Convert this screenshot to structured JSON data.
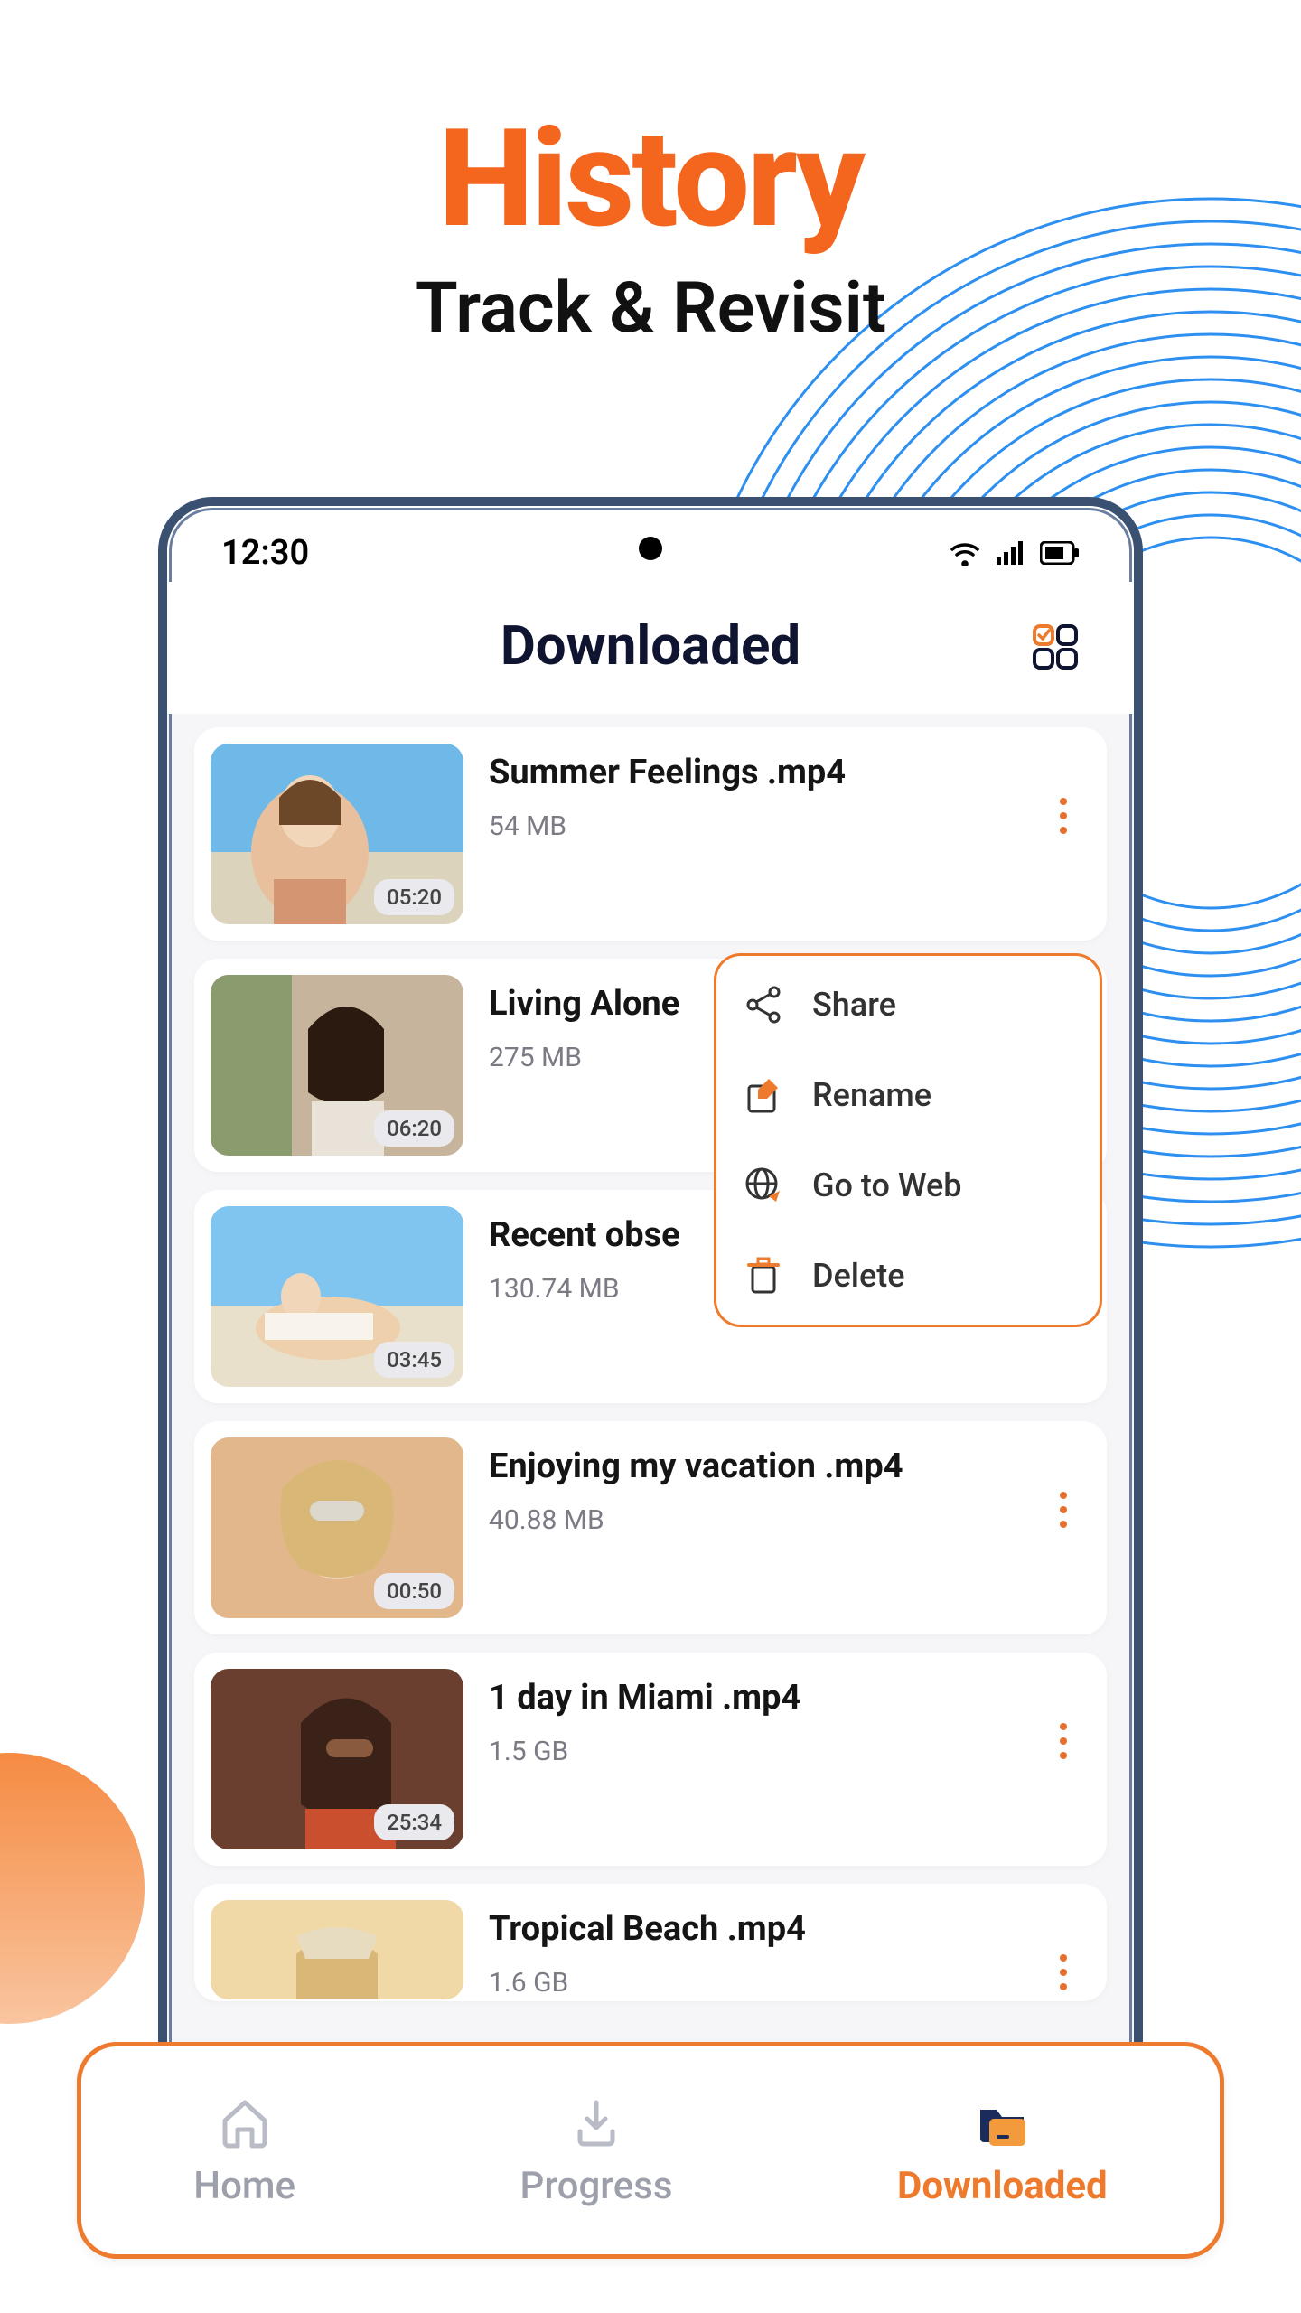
{
  "promo": {
    "title": "History",
    "subtitle": "Track & Revisit"
  },
  "statusBar": {
    "time": "12:30"
  },
  "screen": {
    "title": "Downloaded"
  },
  "items": [
    {
      "title": "Summer Feelings .mp4",
      "size": "54 MB",
      "duration": "05:20"
    },
    {
      "title": "Living Alone",
      "size": "275 MB",
      "duration": "06:20"
    },
    {
      "title": "Recent obse",
      "size": "130.74 MB",
      "duration": "03:45"
    },
    {
      "title": "Enjoying my vacation .mp4",
      "size": "40.88 MB",
      "duration": "00:50"
    },
    {
      "title": "1 day in Miami .mp4",
      "size": "1.5 GB",
      "duration": "25:34"
    },
    {
      "title": "Tropical Beach .mp4",
      "size": "1.6 GB",
      "duration": ""
    }
  ],
  "popup": {
    "share": "Share",
    "rename": "Rename",
    "goToWeb": "Go to Web",
    "delete": "Delete"
  },
  "nav": {
    "home": "Home",
    "progress": "Progress",
    "downloaded": "Downloaded"
  }
}
